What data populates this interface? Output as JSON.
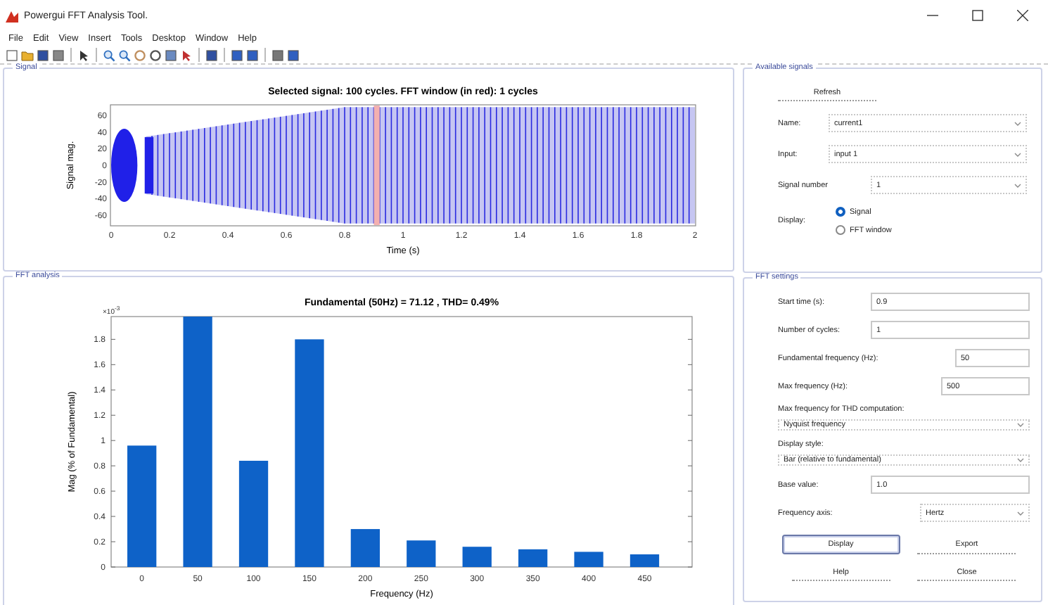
{
  "window": {
    "title": "Powergui FFT Analysis Tool."
  },
  "menu": [
    "File",
    "Edit",
    "View",
    "Insert",
    "Tools",
    "Desktop",
    "Window",
    "Help"
  ],
  "signal_panel": {
    "title": "Signal",
    "plot": {
      "title": "Selected signal: 100 cycles. FFT window (in red): 1 cycles",
      "xlabel": "Time (s)",
      "ylabel": "Signal mag.",
      "xticks": [
        "0",
        "0.2",
        "0.4",
        "0.6",
        "0.8",
        "1",
        "1.2",
        "1.4",
        "1.6",
        "1.8",
        "2"
      ],
      "yticks": [
        "60",
        "40",
        "20",
        "0",
        "-20",
        "-40",
        "-60"
      ]
    }
  },
  "fft_panel": {
    "title": "FFT analysis",
    "chart_data": {
      "type": "bar",
      "title": "Fundamental (50Hz) = 71.12 , THD= 0.49%",
      "xlabel": "Frequency (Hz)",
      "ylabel": "Mag (% of Fundamental)",
      "categories": [
        "0",
        "50",
        "100",
        "150",
        "200",
        "250",
        "300",
        "350",
        "400",
        "450"
      ],
      "values": [
        0.96,
        1.98,
        0.84,
        1.8,
        0.3,
        0.21,
        0.16,
        0.14,
        0.12,
        0.1
      ],
      "ylim": [
        0,
        1.98
      ],
      "yticks": [
        0,
        0.2,
        0.4,
        0.6,
        0.8,
        1,
        1.2,
        1.4,
        1.6,
        1.8
      ],
      "annotations": [
        "×10$^{-3}$"
      ]
    }
  },
  "available_signals": {
    "title": "Available signals",
    "refresh": "Refresh",
    "fields": [
      {
        "label": "Name:",
        "value": "current1",
        "kind": "dropdown"
      },
      {
        "label": "Input:",
        "value": "input 1",
        "kind": "dropdown"
      },
      {
        "label": "Signal number",
        "value": "1",
        "kind": "dropdown"
      }
    ],
    "display": {
      "label": "Display:",
      "options": [
        {
          "label": "Signal",
          "selected": true
        },
        {
          "label": "FFT window",
          "selected": false
        }
      ]
    }
  },
  "fft_settings": {
    "title": "FFT settings",
    "fields": [
      {
        "label": "Start time (s):",
        "value": "0.9",
        "kind": "input"
      },
      {
        "label": "Number of cycles:",
        "value": "1",
        "kind": "input"
      },
      {
        "label": "Fundamental frequency (Hz):",
        "value": "50",
        "kind": "input"
      },
      {
        "label": "Max frequency (Hz):",
        "value": "500",
        "kind": "input"
      },
      {
        "label": "Max frequency for THD computation:",
        "value": "Nyquist frequency",
        "kind": "stacked-dropdown"
      },
      {
        "label": "Display style:",
        "value": "Bar (relative to fundamental)",
        "kind": "stacked-dropdown"
      },
      {
        "label": "Base value:",
        "value": "1.0",
        "kind": "input"
      },
      {
        "label": "Frequency axis:",
        "value": "Hertz",
        "kind": "dropdown"
      }
    ],
    "buttons": [
      {
        "label": "Display",
        "kind": "boxed"
      },
      {
        "label": "Export",
        "kind": "flat"
      },
      {
        "label": "Help",
        "kind": "flat"
      },
      {
        "label": "Close",
        "kind": "flat"
      }
    ]
  }
}
